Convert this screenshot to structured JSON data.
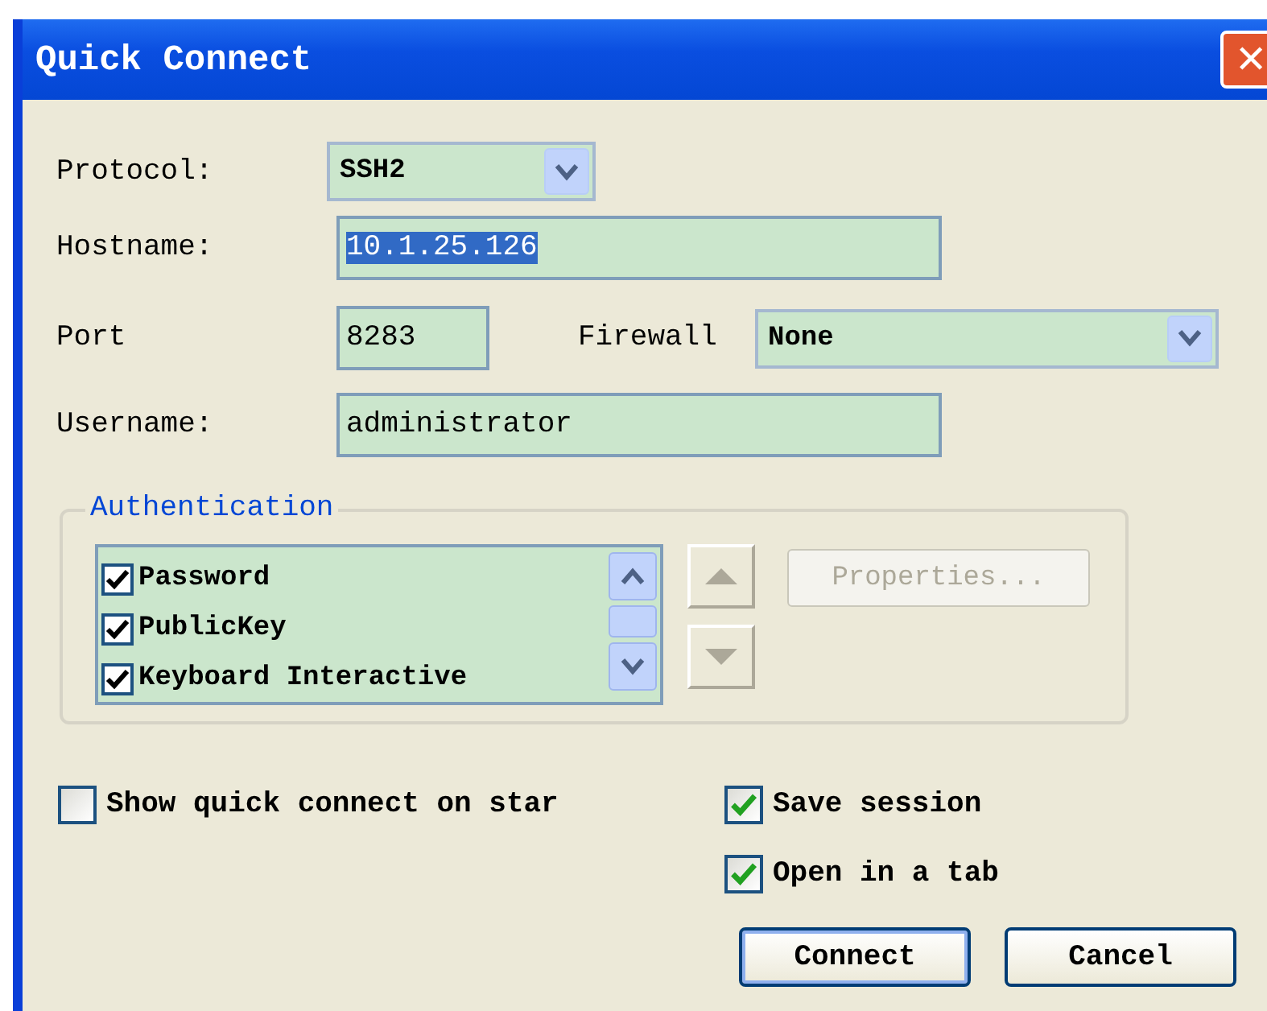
{
  "window": {
    "title": "Quick Connect",
    "close": "✕"
  },
  "protocol": {
    "label": "Protocol:",
    "value": "SSH2"
  },
  "hostname": {
    "label": "Hostname:",
    "value": "10.1.25.126",
    "selected": true
  },
  "port": {
    "label": "Port",
    "value": "8283"
  },
  "firewall": {
    "label": "Firewall",
    "value": "None"
  },
  "username": {
    "label": "Username:",
    "value": "administrator"
  },
  "authentication": {
    "title": "Authentication",
    "methods": [
      {
        "label": "Password",
        "checked": true
      },
      {
        "label": "PublicKey",
        "checked": true
      },
      {
        "label": "Keyboard Interactive",
        "checked": true
      }
    ],
    "properties": {
      "label": "Properties...",
      "disabled": true
    }
  },
  "options": [
    {
      "label": "Show quick connect on star",
      "checked": false
    },
    {
      "label": "Save session",
      "checked": true
    },
    {
      "label": "Open in a tab",
      "checked": true
    }
  ],
  "buttons": [
    {
      "label": "Connect",
      "default": true
    },
    {
      "label": "Cancel",
      "default": false
    }
  ]
}
